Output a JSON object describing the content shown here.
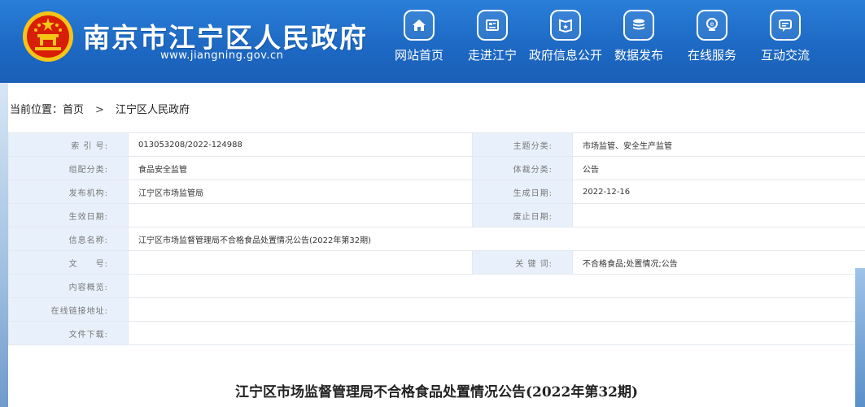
{
  "header": {
    "site_title": "南京市江宁区人民政府",
    "site_url": "www.jiangning.gov.cn",
    "nav": [
      {
        "label": "网站首页",
        "icon": "home-icon"
      },
      {
        "label": "走进江宁",
        "icon": "news-icon"
      },
      {
        "label": "政府信息公开",
        "icon": "open-info-icon"
      },
      {
        "label": "数据发布",
        "icon": "database-icon"
      },
      {
        "label": "在线服务",
        "icon": "service-icon"
      },
      {
        "label": "互动交流",
        "icon": "chat-icon"
      }
    ],
    "colors": {
      "background": "#1d69c4",
      "text": "#ffffff"
    }
  },
  "breadcrumb": {
    "prefix": "当前位置：",
    "home": "首页",
    "separator": ">",
    "current": "江宁区人民政府"
  },
  "meta": {
    "index_no_label": "索 引 号:",
    "index_no": "013053208/2022-124988",
    "topic_label": "主题分类:",
    "topic": "市场监管、安全生产监管",
    "org_category_label": "组配分类:",
    "org_category": "食品安全监管",
    "genre_label": "体裁分类:",
    "genre": "公告",
    "issuer_label": "发布机构:",
    "issuer": "江宁区市场监管局",
    "created_label": "生成日期:",
    "created": "2022-12-16",
    "effective_label": "生效日期:",
    "effective": "",
    "expiry_label": "废止日期:",
    "expiry": "",
    "info_name_label": "信息名称:",
    "info_name": "江宁区市场监督管理局不合格食品处置情况公告(2022年第32期)",
    "doc_no_label": "文　　号:",
    "doc_no": "",
    "keywords_label": "关 键 词:",
    "keywords": "不合格食品;处置情况;公告",
    "summary_label": "内容概览:",
    "summary": "",
    "link_label": "在线链接地址:",
    "link": "",
    "download_label": "文件下载:",
    "download": ""
  },
  "document": {
    "title": "江宁区市场监督管理局不合格食品处置情况公告(2022年第32期)"
  }
}
